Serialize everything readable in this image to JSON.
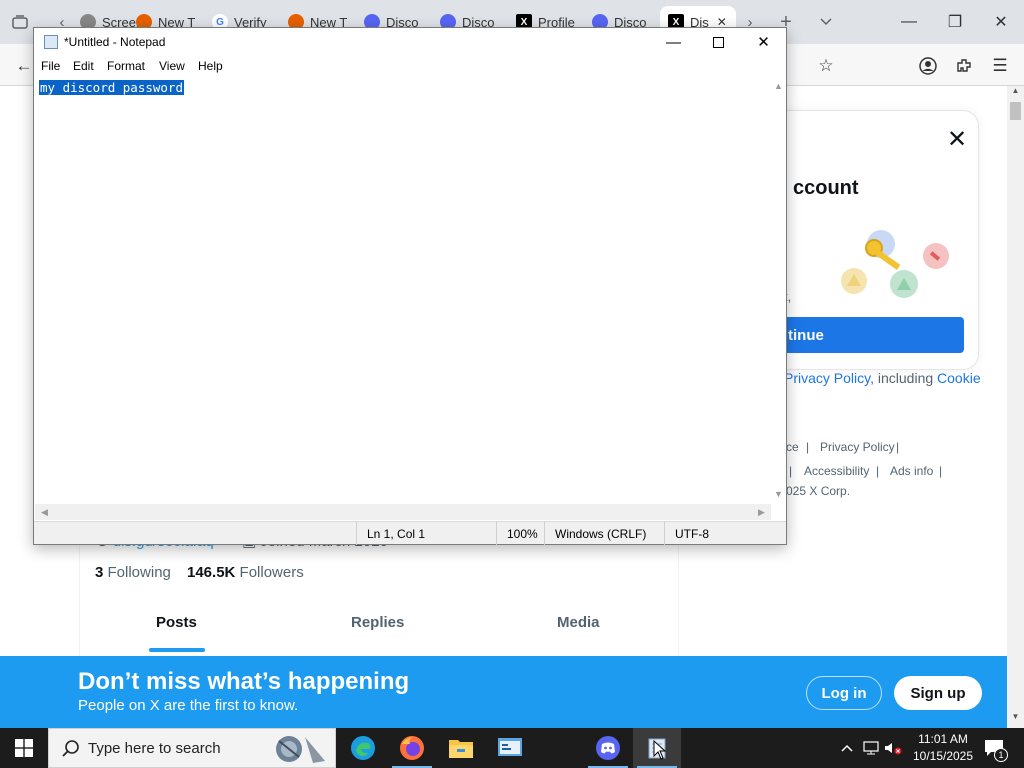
{
  "browser": {
    "tabs": [
      {
        "label": "Screen",
        "fav_color": "#888888"
      },
      {
        "label": "New T",
        "fav_color": "#e66000"
      },
      {
        "label": "Verify",
        "fav_color": "#4285f4"
      },
      {
        "label": "New T",
        "fav_color": "#e66000"
      },
      {
        "label": "Disco",
        "fav_color": "#5865f2"
      },
      {
        "label": "Disco",
        "fav_color": "#5865f2"
      },
      {
        "label": "Profile",
        "fav_color": "#000000"
      },
      {
        "label": "Disco",
        "fav_color": "#5865f2"
      },
      {
        "label": "Dis",
        "fav_color": "#000000"
      }
    ],
    "new_tab_label": "+",
    "tab_list_label": "⌄",
    "window_controls": {
      "minimize": "—",
      "maximize": "❐",
      "close": "✕"
    }
  },
  "xpage": {
    "link_partial": "dis.gd/5c6lafaq",
    "joined_partial": "Joined March 2020",
    "following_count": "3",
    "following_label": "Following",
    "followers_count": "146.5K",
    "followers_label": "Followers",
    "tabs": [
      "Posts",
      "Replies",
      "Media"
    ],
    "modal": {
      "close_label": "✕",
      "heading_partial": "ccount",
      "text_partial": "t,",
      "button_partial": "tinue"
    },
    "policy_line": {
      "link1": "Privacy Policy",
      "middle": ", including ",
      "link2": "Cookie"
    },
    "footer": {
      "row1": [
        "ce",
        "Privacy Policy"
      ],
      "row2": [
        "Accessibility",
        "Ads info"
      ],
      "copyright_partial": "025 X Corp."
    },
    "banner": {
      "title": "Don’t miss what’s happening",
      "subtitle": "People on X are the first to know.",
      "login": "Log in",
      "signup": "Sign up"
    }
  },
  "notepad": {
    "title": "*Untitled - Notepad",
    "menus": [
      "File",
      "Edit",
      "Format",
      "View",
      "Help"
    ],
    "content": "my discord password",
    "status": {
      "position": "Ln 1, Col 1",
      "zoom": "100%",
      "line_endings": "Windows (CRLF)",
      "encoding": "UTF-8"
    }
  },
  "taskbar": {
    "search_placeholder": "Type here to search",
    "apps": [
      "edge-icon",
      "firefox-icon",
      "file-explorer-icon",
      "control-panel-icon",
      "discord-icon",
      "notepad-icon"
    ],
    "time": "11:01 AM",
    "date": "10/15/2025",
    "notification_count": "1"
  },
  "colors": {
    "x_blue": "#1d9bf0",
    "selection_blue": "#0a64c8",
    "taskbar": "#1c1c1c"
  }
}
